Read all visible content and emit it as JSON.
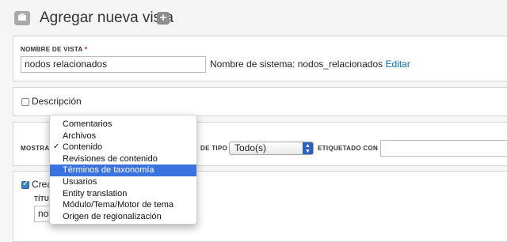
{
  "header": {
    "title": "Agregar nueva vista",
    "add_symbol": "+"
  },
  "view_name": {
    "label": "Nombre de vista",
    "required_mark": "*",
    "value": "nodos relacionados",
    "system_name_label": "Nombre de sistema: nodos_relacionados",
    "edit_link": "Editar"
  },
  "description": {
    "label": "Descripción",
    "checked": false
  },
  "show": {
    "label_partial": "Mostra",
    "type_label": "de tipo",
    "type_value": "Todo(s)",
    "tagged_label": "etiquetado con",
    "tagged_value": "",
    "dropdown": {
      "items": [
        "Comentarios",
        "Archivos",
        "Contenido",
        "Revisiones de contenido",
        "Términos de taxonomía",
        "Usuarios",
        "Entity translation",
        "Módulo/Tema/Motor de tema",
        "Origen de regionalización"
      ],
      "checked_item": "Contenido",
      "highlighted_item": "Términos de taxonomía"
    }
  },
  "create_page": {
    "label_partial": "Crea",
    "checked": true,
    "title_label_partial": "Títu",
    "title_value_partial": "nod"
  },
  "colors": {
    "accent": "#3a73e0",
    "link": "#0074bd",
    "checkbox": "#3b83c8"
  }
}
